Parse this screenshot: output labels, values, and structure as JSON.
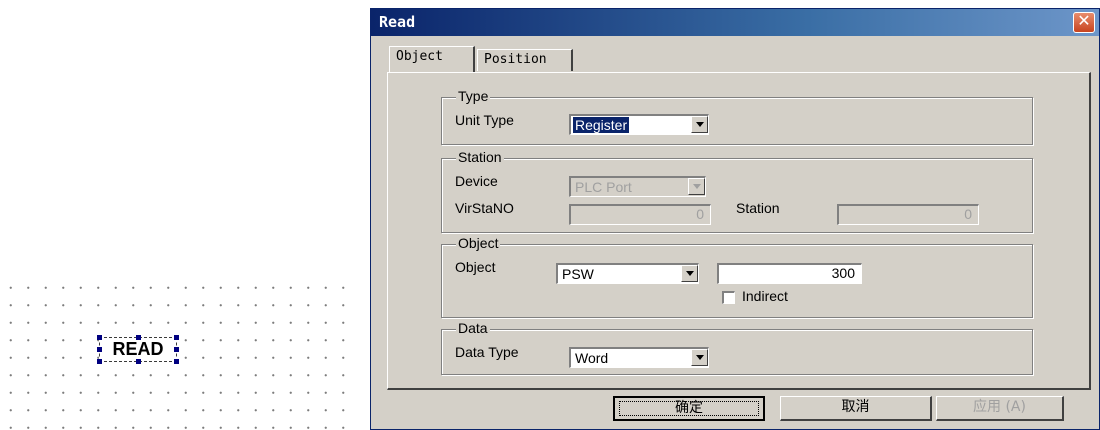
{
  "canvas": {
    "object_text": "READ"
  },
  "dialog": {
    "title": "Read",
    "tabs": [
      {
        "label": "Object",
        "active": true
      },
      {
        "label": "Position",
        "active": false
      }
    ],
    "groups": {
      "type": {
        "legend": "Type",
        "unit_type_label": "Unit Type",
        "unit_type_value": "Register"
      },
      "station": {
        "legend": "Station",
        "device_label": "Device",
        "device_value": "PLC Port",
        "virstano_label": "VirStaNO",
        "virstano_value": "0",
        "station_label": "Station",
        "station_value": "0"
      },
      "object": {
        "legend": "Object",
        "object_label": "Object",
        "object_value": "PSW",
        "address_value": "300",
        "indirect_label": "Indirect",
        "indirect_checked": false
      },
      "data": {
        "legend": "Data",
        "data_type_label": "Data Type",
        "data_type_value": "Word"
      }
    },
    "buttons": {
      "ok": "确定",
      "cancel": "取消",
      "apply": "应用 (A)"
    }
  }
}
